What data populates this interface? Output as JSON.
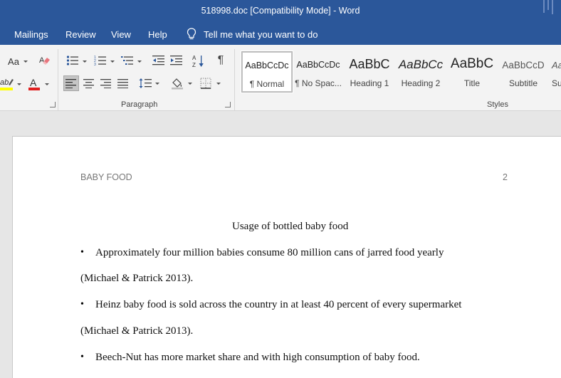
{
  "window": {
    "title": "518998.doc [Compatibility Mode]  -  Word"
  },
  "menu": {
    "items": [
      "Mailings",
      "Review",
      "View",
      "Help"
    ],
    "tell_me": "Tell me what you want to do"
  },
  "ribbon": {
    "font": {
      "change_case_label": "Aa"
    },
    "paragraph": {
      "group_label": "Paragraph"
    },
    "styles": {
      "group_label": "Styles",
      "tiles": [
        {
          "preview": "AaBbCcDc",
          "name": "¶ Normal"
        },
        {
          "preview": "AaBbCcDc",
          "name": "¶ No Spac..."
        },
        {
          "preview": "AaBbC",
          "name": "Heading 1"
        },
        {
          "preview": "AaBbCc",
          "name": "Heading 2"
        },
        {
          "preview": "AaBbC",
          "name": "Title"
        },
        {
          "preview": "AaBbCcD",
          "name": "Subtitle"
        },
        {
          "preview": "Aa",
          "name": "Su"
        }
      ]
    }
  },
  "colors": {
    "title_bar": "#2b579a",
    "highlight": "#ffff00",
    "font_color": "#e02020"
  },
  "document": {
    "header": "BABY FOOD",
    "page_number": "2",
    "title": "Usage of bottled baby food",
    "bullets": [
      {
        "line1": "Approximately four million babies consume 80 million cans of jarred food yearly",
        "line2": "(Michael & Patrick 2013)."
      },
      {
        "line1": "Heinz baby food is sold across the country in at least 40 percent of every supermarket",
        "line2": "(Michael & Patrick 2013)."
      },
      {
        "line1": "Beech-Nut has more market share and with high consumption of baby food.",
        "line2": ""
      }
    ]
  }
}
